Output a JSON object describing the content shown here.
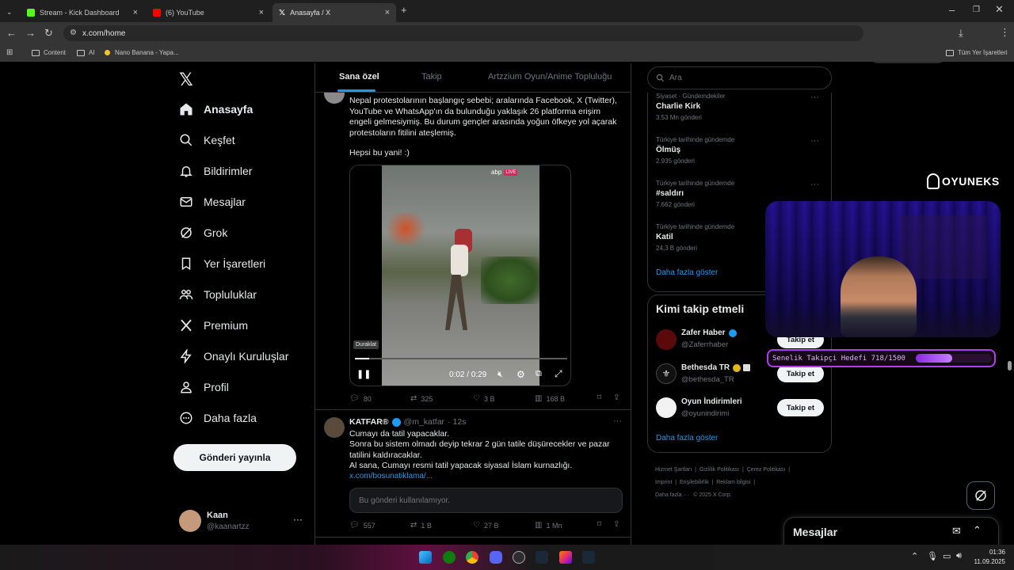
{
  "browser": {
    "tabs": [
      {
        "title": "Stream - Kick Dashboard",
        "active": false
      },
      {
        "title": "(6) YouTube",
        "active": false
      },
      {
        "title": "Anasayfa / X",
        "active": true
      }
    ],
    "address": "x.com/home",
    "bookmarks": [
      "Content",
      "AI",
      "Nano Banana - Yapa...",
      "Tüm Yer İşaretleri"
    ]
  },
  "nav": {
    "items": [
      "Anasayfa",
      "Keşfet",
      "Bildirimler",
      "Mesajlar",
      "Grok",
      "Yer İşaretleri",
      "Topluluklar",
      "Premium",
      "Onaylı Kuruluşlar",
      "Profil",
      "Daha fazla"
    ],
    "post_label": "Gönderi yayınla",
    "user_name": "Kaan",
    "user_handle": "@kaanartzz"
  },
  "feed": {
    "tabs": [
      "Sana özel",
      "Takip",
      "Artzzium Oyun/Anime Topluluğu"
    ],
    "tweet1": {
      "text": "Nepal protestolarının başlangıç sebebi; aralarında Facebook, X (Twitter), YouTube ve WhatsApp'ın da bulunduğu yaklaşık 26 platforma erişim engeli gelmesiymiş. Bu durum gençler arasında yoğun öfkeye yol açarak protestoların fitilini ateşlemiş.",
      "text2": "Hepsi bu yani! :)",
      "video_badge": "abp",
      "video_live": "LIVE",
      "tooltip": "Duraklat",
      "video_time": "0:02 / 0:29",
      "replies": "80",
      "reposts": "325",
      "likes": "3 B",
      "views": "168 B"
    },
    "tweet2": {
      "author": "KATFAR®",
      "handle": "@m_katfar",
      "time": "· 12s",
      "lines": [
        "Cumayı da tatil yapacaklar.",
        "Sonra bu sistem olmadı deyip tekrar 2 gün tatile düşürecekler ve pazar tatilini kaldıracaklar.",
        "Al sana, Cumayı resmi tatil yapacak siyasal İslam kurnazlığı."
      ],
      "link": "x.com/bosunatiklama/...",
      "unavailable": "Bu gönderi kullanılamıyor.",
      "replies": "557",
      "reposts": "1 B",
      "likes": "27 B",
      "views": "1 Mn"
    }
  },
  "right": {
    "search_placeholder": "Ara",
    "trends": [
      {
        "context": "Siyaset · Gündemdekiler",
        "title": "Charlie Kirk",
        "count": "3,53 Mn gönderi"
      },
      {
        "context": "Türkiye tarihinde gündemde",
        "title": "Ölmüş",
        "count": "2.935 gönderi"
      },
      {
        "context": "Türkiye tarihinde gündemde",
        "title": "#saldırı",
        "count": "7.662 gönderi"
      },
      {
        "context": "Türkiye tarihinde gündemde",
        "title": "Katil",
        "count": "24,3 B gönderi"
      }
    ],
    "show_more": "Daha fazla göster",
    "who_to_follow": "Kimi takip etmeli",
    "suggestions": [
      {
        "name": "Zafer Haber",
        "handle": "@Zaferrhaber"
      },
      {
        "name": "Bethesda TR",
        "handle": "@bethesda_TR"
      },
      {
        "name": "Oyun İndirimleri",
        "handle": "@oyunindirimi"
      }
    ],
    "follow_label": "Takip et",
    "footer": [
      "Hizmet Şartları",
      "Gizlilik Politikası",
      "Çerez Politikası",
      "Imprint",
      "Erişilebilirlik",
      "Reklam bilgisi",
      "Daha fazla ···",
      "© 2025 X Corp."
    ]
  },
  "messages_dock": "Mesajlar",
  "overlay": {
    "logo": "OYUNEKS",
    "goal_text": "Senelik Takipçi Hedefi 718/1500",
    "goal_progress": 0.479
  },
  "taskbar": {
    "time": "01:36",
    "date": "11.09.2025"
  }
}
